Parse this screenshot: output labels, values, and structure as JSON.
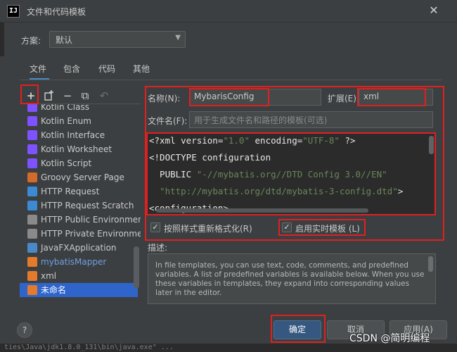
{
  "window": {
    "title": "文件和代码模板",
    "app_icon_text": "IJ"
  },
  "scheme": {
    "label": "方案:",
    "value": "默认"
  },
  "tabs": [
    "文件",
    "包含",
    "代码",
    "其他"
  ],
  "toolbar": {
    "add": "+",
    "copy_label": "复制",
    "remove": "−",
    "duplicate": "⧉",
    "revert": "↶"
  },
  "file_list": [
    {
      "label": "Kotlin Class",
      "icon_color": "#7f52ff"
    },
    {
      "label": "Kotlin Enum",
      "icon_color": "#7f52ff"
    },
    {
      "label": "Kotlin Interface",
      "icon_color": "#7f52ff"
    },
    {
      "label": "Kotlin Worksheet",
      "icon_color": "#7f52ff"
    },
    {
      "label": "Kotlin Script",
      "icon_color": "#7f52ff"
    },
    {
      "label": "Groovy Server Page",
      "icon_color": "#d26a2c"
    },
    {
      "label": "HTTP Request",
      "icon_color": "#3d8ad4"
    },
    {
      "label": "HTTP Request Scratch",
      "icon_color": "#3d8ad4"
    },
    {
      "label": "HTTP Public Environment",
      "icon_color": "#8a8a8a"
    },
    {
      "label": "HTTP Private Environment",
      "icon_color": "#8a8a8a"
    },
    {
      "label": "JavaFXApplication",
      "icon_color": "#4a88c7"
    },
    {
      "label": "mybatisMapper",
      "icon_color": "#e47a2c",
      "highlight": true
    },
    {
      "label": "xml",
      "icon_color": "#e47a2c"
    },
    {
      "label": "未命名",
      "icon_color": "#e47a2c",
      "selected": true
    }
  ],
  "form": {
    "name_label": "名称(N):",
    "name_value": "MybarisConfig",
    "ext_label": "扩展(E):",
    "ext_value": "xml",
    "filename_label": "文件名(F):",
    "filename_placeholder": "用于生成文件名和路径的模板(可选)"
  },
  "code_lines": [
    {
      "a": "<?xml version=",
      "b": "\"1.0\"",
      "c": " encoding=",
      "d": "\"UTF-8\"",
      "e": " ?>"
    },
    {
      "a": "<!DOCTYPE configuration",
      "b": "",
      "c": "",
      "d": "",
      "e": ""
    },
    {
      "a": "  PUBLIC ",
      "b": "\"-//mybatis.org//DTD Config 3.0//EN\"",
      "c": "",
      "d": "",
      "e": ""
    },
    {
      "a": "  ",
      "b": "\"http://mybatis.org/dtd/mybatis-3-config.dtd\"",
      "c": "",
      "d": "",
      "e": ">"
    },
    {
      "a": "<configuration>",
      "b": "",
      "c": "",
      "d": "",
      "e": ""
    }
  ],
  "options": {
    "reformat": "按照样式重新格式化(R)",
    "live_template": "启用实时模板 (L)"
  },
  "description": {
    "label": "描述:",
    "text": "In file templates, you can use text, code, comments, and predefined variables. A list of predefined variables is available below. When you use these variables in templates, they expand into corresponding values later in the editor."
  },
  "buttons": {
    "help": "?",
    "ok": "确定",
    "cancel": "取消",
    "apply": "应用(A)"
  },
  "background_text": "ties\\Java\\jdk1.8.0_131\\bin\\java.exe\" ...",
  "watermark": "CSDN @简明编程"
}
